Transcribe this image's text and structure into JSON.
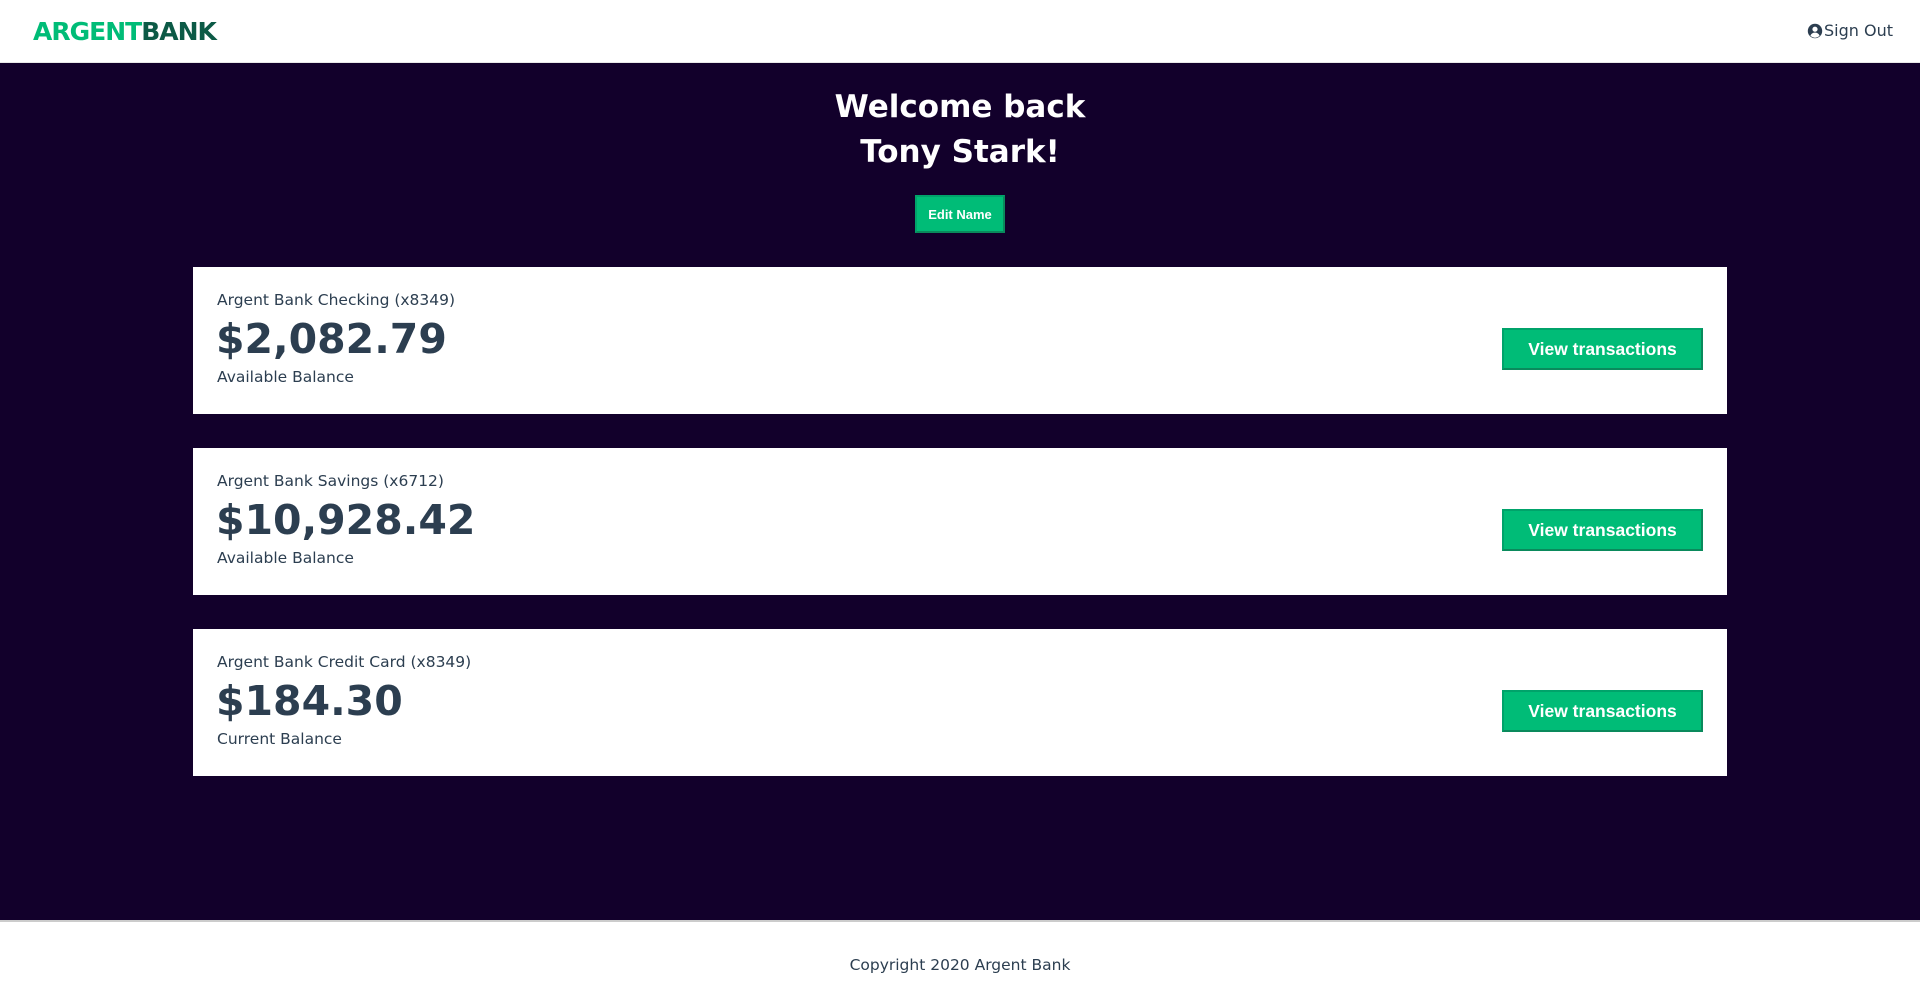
{
  "header": {
    "logo_part1": "ARGENT",
    "logo_part2": "BANK",
    "signout_label": "Sign Out",
    "signout_icon": "user-circle-icon"
  },
  "welcome": {
    "line1": "Welcome back",
    "line2": "Tony Stark!",
    "edit_label": "Edit Name"
  },
  "accounts": [
    {
      "title": "Argent Bank Checking (x8349)",
      "amount": "$2,082.79",
      "description": "Available Balance",
      "button_label": "View transactions"
    },
    {
      "title": "Argent Bank Savings (x6712)",
      "amount": "$10,928.42",
      "description": "Available Balance",
      "button_label": "View transactions"
    },
    {
      "title": "Argent Bank Credit Card (x8349)",
      "amount": "$184.30",
      "description": "Current Balance",
      "button_label": "View transactions"
    }
  ],
  "footer": {
    "copyright": "Copyright 2020 Argent Bank"
  },
  "colors": {
    "brand_green": "#00bc77",
    "brand_dark_green": "#0c5a46",
    "background_dark": "#12002b",
    "text_dark": "#2c3e50"
  }
}
